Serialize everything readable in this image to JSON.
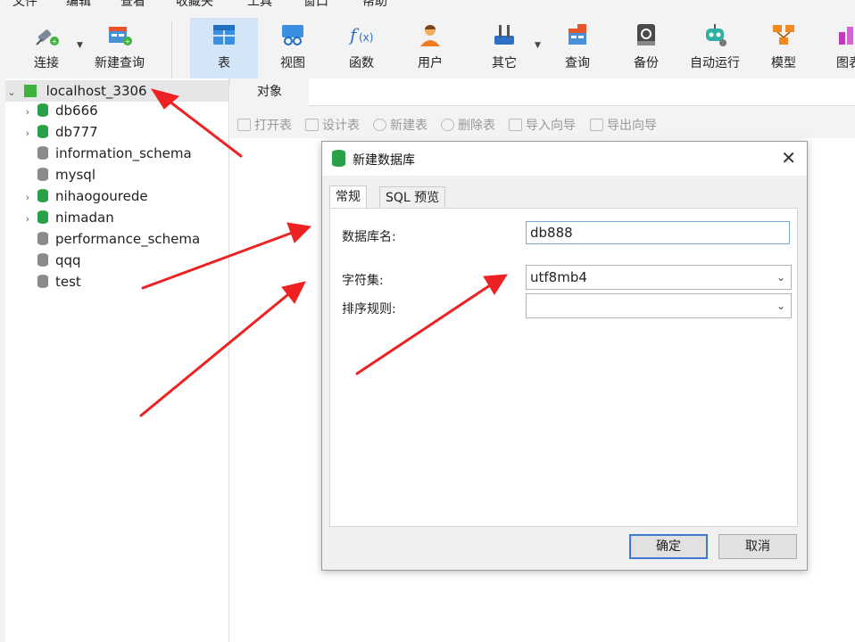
{
  "menu": [
    "文件",
    "编辑",
    "查看",
    "收藏夹",
    "工具",
    "窗口",
    "帮助"
  ],
  "toolbar": {
    "connect": "连接",
    "new_query": "新建查询",
    "table": "表",
    "view": "视图",
    "function": "函数",
    "user": "用户",
    "other": "其它",
    "query": "查询",
    "backup": "备份",
    "auto_run": "自动运行",
    "model": "模型",
    "chart": "图表"
  },
  "tree": {
    "connection": "localhost_3306",
    "databases": [
      {
        "name": "db666",
        "open": true,
        "expandable": true
      },
      {
        "name": "db777",
        "open": true,
        "expandable": true
      },
      {
        "name": "information_schema",
        "open": false,
        "expandable": false
      },
      {
        "name": "mysql",
        "open": false,
        "expandable": false
      },
      {
        "name": "nihaogourede",
        "open": true,
        "expandable": true
      },
      {
        "name": "nimadan",
        "open": true,
        "expandable": true
      },
      {
        "name": "performance_schema",
        "open": false,
        "expandable": false
      },
      {
        "name": "qqq",
        "open": false,
        "expandable": false
      },
      {
        "name": "test",
        "open": false,
        "expandable": false
      }
    ]
  },
  "object_tab": "对象",
  "object_toolbar": {
    "open_table": "打开表",
    "design_table": "设计表",
    "new_table": "新建表",
    "delete_table": "删除表",
    "import_wizard": "导入向导",
    "export_wizard": "导出向导"
  },
  "dialog": {
    "title": "新建数据库",
    "tabs": [
      "常规",
      "SQL 预览"
    ],
    "db_name_label": "数据库名:",
    "db_name_value": "db888",
    "charset_label": "字符集:",
    "charset_value": "utf8mb4",
    "collation_label": "排序规则:",
    "collation_value": "",
    "ok": "确定",
    "cancel": "取消"
  },
  "colors": {
    "active_tool": "#d4e5f7",
    "db_open": "#2aa148",
    "db_closed": "#8a8a8a",
    "arrow": "#ee2222",
    "primary_border": "#3b79d4"
  }
}
